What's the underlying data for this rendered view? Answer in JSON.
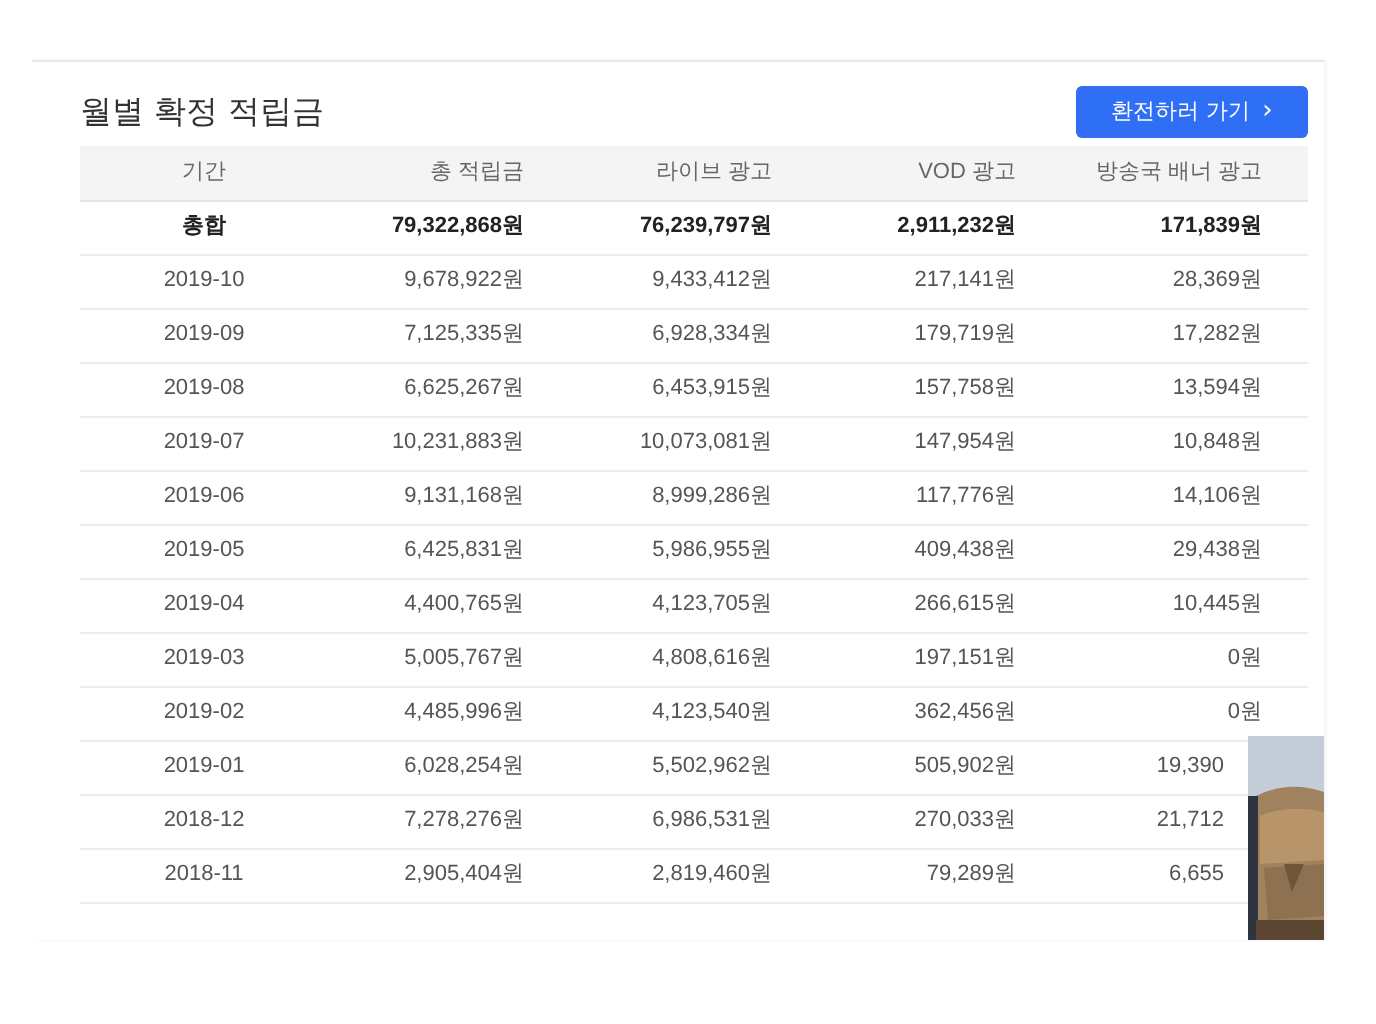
{
  "title": "월별 확정 적립금",
  "action_button": {
    "label": "환전하러 가기",
    "icon": "›"
  },
  "table": {
    "columns": [
      "기간",
      "총 적립금",
      "라이브 광고",
      "VOD 광고",
      "방송국 배너 광고"
    ],
    "rows": [
      {
        "kind": "total",
        "cells": [
          "총합",
          "79,322,868원",
          "76,239,797원",
          "2,911,232원",
          "171,839원"
        ]
      },
      {
        "kind": "month",
        "cells": [
          "2019-10",
          "9,678,922원",
          "9,433,412원",
          "217,141원",
          "28,369원"
        ]
      },
      {
        "kind": "month",
        "cells": [
          "2019-09",
          "7,125,335원",
          "6,928,334원",
          "179,719원",
          "17,282원"
        ]
      },
      {
        "kind": "month",
        "cells": [
          "2019-08",
          "6,625,267원",
          "6,453,915원",
          "157,758원",
          "13,594원"
        ]
      },
      {
        "kind": "month",
        "cells": [
          "2019-07",
          "10,231,883원",
          "10,073,081원",
          "147,954원",
          "10,848원"
        ]
      },
      {
        "kind": "month",
        "cells": [
          "2019-06",
          "9,131,168원",
          "8,999,286원",
          "117,776원",
          "14,106원"
        ]
      },
      {
        "kind": "month",
        "cells": [
          "2019-05",
          "6,425,831원",
          "5,986,955원",
          "409,438원",
          "29,438원"
        ]
      },
      {
        "kind": "month",
        "cells": [
          "2019-04",
          "4,400,765원",
          "4,123,705원",
          "266,615원",
          "10,445원"
        ]
      },
      {
        "kind": "month",
        "cells": [
          "2019-03",
          "5,005,767원",
          "4,808,616원",
          "197,151원",
          "0원"
        ]
      },
      {
        "kind": "month",
        "cells": [
          "2019-02",
          "4,485,996원",
          "4,123,540원",
          "362,456원",
          "0원"
        ]
      },
      {
        "kind": "month",
        "cells": [
          "2019-01",
          "6,028,254원",
          "5,502,962원",
          "505,902원",
          "19,390"
        ]
      },
      {
        "kind": "month",
        "cells": [
          "2018-12",
          "7,278,276원",
          "6,986,531원",
          "270,033원",
          "21,712"
        ]
      },
      {
        "kind": "month",
        "cells": [
          "2018-11",
          "2,905,404원",
          "2,819,460원",
          "79,289원",
          "6,655"
        ]
      }
    ]
  }
}
